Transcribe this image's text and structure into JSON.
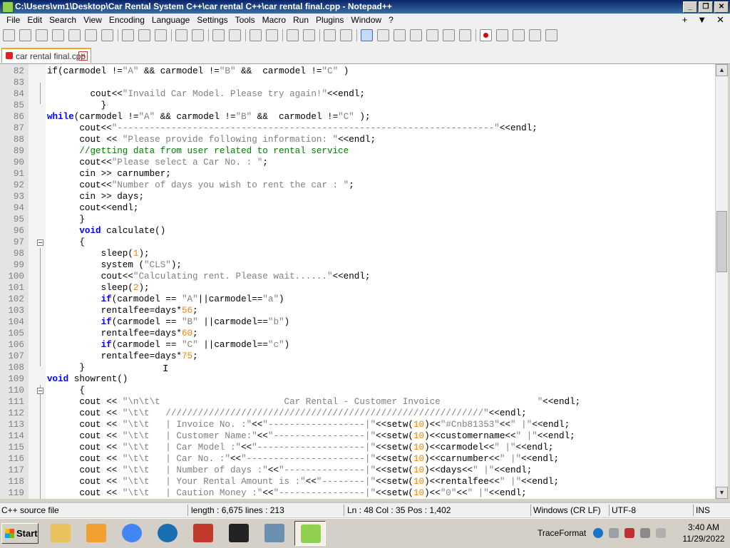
{
  "window": {
    "title": "C:\\Users\\vm1\\Desktop\\Car Rental System C++\\car rental C++\\car rental final.cpp - Notepad++",
    "controls": [
      "_",
      "❐",
      "✕"
    ]
  },
  "menubar": {
    "items": [
      "File",
      "Edit",
      "Search",
      "View",
      "Encoding",
      "Language",
      "Settings",
      "Tools",
      "Macro",
      "Run",
      "Plugins",
      "Window",
      "?"
    ],
    "right": [
      "+",
      "▼",
      "✕"
    ]
  },
  "toolbar": {
    "icons": [
      "new-file-icon",
      "open-file-icon",
      "save-icon",
      "save-all-icon",
      "close-icon",
      "close-all-icon",
      "print-icon",
      "sep",
      "cut-icon",
      "copy-icon",
      "paste-icon",
      "sep",
      "undo-icon",
      "redo-icon",
      "sep",
      "find-icon",
      "replace-icon",
      "sep",
      "zoom-in-icon",
      "zoom-out-icon",
      "sep",
      "sync-vertical-icon",
      "sync-horizontal-icon",
      "sep",
      "word-wrap-icon",
      "show-all-chars-icon",
      "sep",
      "indent-guide-icon",
      "lang-define-icon",
      "doc-map-icon",
      "function-list-icon",
      "folder-workspace-icon",
      "monitoring-icon",
      "eye-icon",
      "sep",
      "record-macro-icon",
      "stop-macro-icon",
      "play-macro-icon",
      "play-multiple-icon",
      "save-macro-icon"
    ]
  },
  "tabs": [
    {
      "label": "car rental final.cpp",
      "close": "✕"
    }
  ],
  "editor": {
    "lines": [
      {
        "n": "82",
        "code": [
          [
            "",
            "if(carmodel !="
          ],
          [
            "str",
            "\"A\""
          ],
          [
            "",
            " && carmodel !="
          ],
          [
            "str",
            "\"B\""
          ],
          [
            "",
            " &&  carmodel !="
          ],
          [
            "str",
            "\"C\""
          ],
          [
            "",
            " )"
          ]
        ]
      },
      {
        "n": "83",
        "code": [
          [
            "",
            ""
          ]
        ]
      },
      {
        "n": "84",
        "code": [
          [
            "",
            "        cout<<"
          ],
          [
            "str",
            "\"Invaild Car Model. Please try again!\""
          ],
          [
            "",
            "<<endl;"
          ]
        ]
      },
      {
        "n": "85",
        "code": [
          [
            "",
            "          }"
          ]
        ]
      },
      {
        "n": "86",
        "code": [
          [
            "kw",
            "while"
          ],
          [
            "",
            "(carmodel !="
          ],
          [
            "str",
            "\"A\""
          ],
          [
            "",
            " && carmodel !="
          ],
          [
            "str",
            "\"B\""
          ],
          [
            "",
            " &&  carmodel !="
          ],
          [
            "str",
            "\"C\""
          ],
          [
            "",
            " );"
          ]
        ]
      },
      {
        "n": "87",
        "code": [
          [
            "",
            "      cout<<"
          ],
          [
            "str",
            "\"----------------------------------------------------------------------\""
          ],
          [
            "",
            "<<endl;"
          ]
        ]
      },
      {
        "n": "88",
        "code": [
          [
            "",
            "      cout << "
          ],
          [
            "str",
            "\"Please provide following information: \""
          ],
          [
            "",
            "<<endl;"
          ]
        ]
      },
      {
        "n": "89",
        "code": [
          [
            "cmt",
            "      //getting data from user related to rental service"
          ]
        ]
      },
      {
        "n": "90",
        "code": [
          [
            "",
            "      cout<<"
          ],
          [
            "str",
            "\"Please select a Car No. : \""
          ],
          [
            "",
            ";"
          ]
        ]
      },
      {
        "n": "91",
        "code": [
          [
            "",
            "      cin >> carnumber;"
          ]
        ]
      },
      {
        "n": "92",
        "code": [
          [
            "",
            "      cout<<"
          ],
          [
            "str",
            "\"Number of days you wish to rent the car : \""
          ],
          [
            "",
            ";"
          ]
        ]
      },
      {
        "n": "93",
        "code": [
          [
            "",
            "      cin >> days;"
          ]
        ]
      },
      {
        "n": "94",
        "code": [
          [
            "",
            "      cout<<endl;"
          ]
        ]
      },
      {
        "n": "95",
        "code": [
          [
            "",
            "      }"
          ]
        ]
      },
      {
        "n": "96",
        "code": [
          [
            "",
            "      "
          ],
          [
            "kw",
            "void"
          ],
          [
            "",
            " calculate()"
          ]
        ]
      },
      {
        "n": "97",
        "code": [
          [
            "",
            "      {"
          ]
        ]
      },
      {
        "n": "98",
        "code": [
          [
            "",
            "          sleep("
          ],
          [
            "num",
            "1"
          ],
          [
            "",
            ");"
          ]
        ]
      },
      {
        "n": "99",
        "code": [
          [
            "",
            "          system ("
          ],
          [
            "str",
            "\"CLS\""
          ],
          [
            "",
            ");"
          ]
        ]
      },
      {
        "n": "100",
        "code": [
          [
            "",
            "          cout<<"
          ],
          [
            "str",
            "\"Calculating rent. Please wait......\""
          ],
          [
            "",
            "<<endl;"
          ]
        ]
      },
      {
        "n": "101",
        "code": [
          [
            "",
            "          sleep("
          ],
          [
            "num",
            "2"
          ],
          [
            "",
            ");"
          ]
        ]
      },
      {
        "n": "102",
        "code": [
          [
            "",
            "          "
          ],
          [
            "kw",
            "if"
          ],
          [
            "",
            "(carmodel == "
          ],
          [
            "str",
            "\"A\""
          ],
          [
            "",
            "||carmodel=="
          ],
          [
            "str",
            "\"a\""
          ],
          [
            "",
            ")"
          ]
        ]
      },
      {
        "n": "103",
        "code": [
          [
            "",
            "          rentalfee=days*"
          ],
          [
            "num",
            "56"
          ],
          [
            "",
            ";"
          ]
        ]
      },
      {
        "n": "104",
        "code": [
          [
            "",
            "          "
          ],
          [
            "kw",
            "if"
          ],
          [
            "",
            "(carmodel == "
          ],
          [
            "str",
            "\"B\""
          ],
          [
            "",
            " ||carmodel=="
          ],
          [
            "str",
            "\"b\""
          ],
          [
            "",
            ")"
          ]
        ]
      },
      {
        "n": "105",
        "code": [
          [
            "",
            "          rentalfee=days*"
          ],
          [
            "num",
            "60"
          ],
          [
            "",
            ";"
          ]
        ]
      },
      {
        "n": "106",
        "code": [
          [
            "",
            "          "
          ],
          [
            "kw",
            "if"
          ],
          [
            "",
            "(carmodel == "
          ],
          [
            "str",
            "\"C\""
          ],
          [
            "",
            " ||carmodel=="
          ],
          [
            "str",
            "\"c\""
          ],
          [
            "",
            ")"
          ]
        ]
      },
      {
        "n": "107",
        "code": [
          [
            "",
            "          rentalfee=days*"
          ],
          [
            "num",
            "75"
          ],
          [
            "",
            ";"
          ]
        ]
      },
      {
        "n": "108",
        "code": [
          [
            "",
            "      }"
          ]
        ]
      },
      {
        "n": "109",
        "code": [
          [
            "kw",
            "void"
          ],
          [
            "",
            " showrent()"
          ]
        ]
      },
      {
        "n": "110",
        "code": [
          [
            "",
            "      {"
          ]
        ]
      },
      {
        "n": "111",
        "code": [
          [
            "",
            "      cout << "
          ],
          [
            "str",
            "\"\\n\\t\\t                       Car Rental - Customer Invoice                  \""
          ],
          [
            "",
            "<<endl;"
          ]
        ]
      },
      {
        "n": "112",
        "code": [
          [
            "",
            "      cout << "
          ],
          [
            "str",
            "\"\\t\\t   ///////////////////////////////////////////////////////////\""
          ],
          [
            "",
            "<<endl;"
          ]
        ]
      },
      {
        "n": "113",
        "code": [
          [
            "",
            "      cout << "
          ],
          [
            "str",
            "\"\\t\\t   | Invoice No. :\""
          ],
          [
            "",
            "<<"
          ],
          [
            "str",
            "\"------------------|\""
          ],
          [
            "",
            "<<setw("
          ],
          [
            "num",
            "10"
          ],
          [
            "",
            ")<<"
          ],
          [
            "str",
            "\"#Cnb81353\""
          ],
          [
            "",
            "<<"
          ],
          [
            "str",
            "\" |\""
          ],
          [
            "",
            "<<endl;"
          ]
        ]
      },
      {
        "n": "114",
        "code": [
          [
            "",
            "      cout << "
          ],
          [
            "str",
            "\"\\t\\t   | Customer Name:\""
          ],
          [
            "",
            "<<"
          ],
          [
            "str",
            "\"-----------------|\""
          ],
          [
            "",
            "<<setw("
          ],
          [
            "num",
            "10"
          ],
          [
            "",
            ")<<customername<<"
          ],
          [
            "str",
            "\" |\""
          ],
          [
            "",
            "<<endl;"
          ]
        ]
      },
      {
        "n": "115",
        "code": [
          [
            "",
            "      cout << "
          ],
          [
            "str",
            "\"\\t\\t   | Car Model :\""
          ],
          [
            "",
            "<<"
          ],
          [
            "str",
            "\"--------------------|\""
          ],
          [
            "",
            "<<setw("
          ],
          [
            "num",
            "10"
          ],
          [
            "",
            ")<<carmodel<<"
          ],
          [
            "str",
            "\" |\""
          ],
          [
            "",
            "<<endl;"
          ]
        ]
      },
      {
        "n": "116",
        "code": [
          [
            "",
            "      cout << "
          ],
          [
            "str",
            "\"\\t\\t   | Car No. :\""
          ],
          [
            "",
            "<<"
          ],
          [
            "str",
            "\"----------------------|\""
          ],
          [
            "",
            "<<setw("
          ],
          [
            "num",
            "10"
          ],
          [
            "",
            ")<<carnumber<<"
          ],
          [
            "str",
            "\" |\""
          ],
          [
            "",
            "<<endl;"
          ]
        ]
      },
      {
        "n": "117",
        "code": [
          [
            "",
            "      cout << "
          ],
          [
            "str",
            "\"\\t\\t   | Number of days :\""
          ],
          [
            "",
            "<<"
          ],
          [
            "str",
            "\"---------------|\""
          ],
          [
            "",
            "<<setw("
          ],
          [
            "num",
            "10"
          ],
          [
            "",
            ")<<days<<"
          ],
          [
            "str",
            "\" |\""
          ],
          [
            "",
            "<<endl;"
          ]
        ]
      },
      {
        "n": "118",
        "code": [
          [
            "",
            "      cout << "
          ],
          [
            "str",
            "\"\\t\\t   | Your Rental Amount is :\""
          ],
          [
            "",
            "<<"
          ],
          [
            "str",
            "\"--------|\""
          ],
          [
            "",
            "<<setw("
          ],
          [
            "num",
            "10"
          ],
          [
            "",
            ")<<rentalfee<<"
          ],
          [
            "str",
            "\" |\""
          ],
          [
            "",
            "<<endl;"
          ]
        ]
      },
      {
        "n": "119",
        "code": [
          [
            "",
            "      cout << "
          ],
          [
            "str",
            "\"\\t\\t   | Caution Money :\""
          ],
          [
            "",
            "<<"
          ],
          [
            "str",
            "\"----------------|\""
          ],
          [
            "",
            "<<setw("
          ],
          [
            "num",
            "10"
          ],
          [
            "",
            ")<<"
          ],
          [
            "str",
            "\"0\""
          ],
          [
            "",
            "<<"
          ],
          [
            "str",
            "\" |\""
          ],
          [
            "",
            "<<endl;"
          ]
        ]
      }
    ],
    "fold_markers": [
      "97",
      "110"
    ]
  },
  "statusbar": {
    "language": "C++ source file",
    "length_lines": "length : 6,675    lines : 213",
    "position": "Ln : 48    Col : 35    Pos : 1,402",
    "eol": "Windows (CR LF)",
    "encoding": "UTF-8",
    "mode": "INS"
  },
  "taskbar": {
    "start_label": "Start",
    "apps": [
      "file-explorer-icon",
      "media-player-icon",
      "chrome-icon",
      "ccleaner-icon",
      "antivirus-icon",
      "7zip-icon",
      "notepad-icon",
      "notepadpp-icon"
    ],
    "tray_label": "TraceFormat",
    "time": "3:40 AM",
    "date": "11/29/2022"
  }
}
